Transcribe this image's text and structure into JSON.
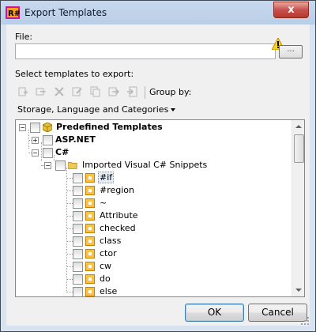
{
  "window": {
    "title": "Export Templates",
    "close_glyph": "x"
  },
  "file": {
    "label": "File:",
    "value": "",
    "placeholder": "",
    "browse_label": "...",
    "warning_icon": "warning-icon"
  },
  "templates": {
    "label": "Select templates to export:",
    "toolbar_icons": [
      "add-icon",
      "add-child-icon",
      "delete-icon",
      "edit-icon",
      "duplicate-icon",
      "move-icon",
      "export-icon"
    ],
    "group_by_label": "Group by:",
    "group_by_value": "Storage, Language and Categories"
  },
  "tree": {
    "root": "Predefined Templates",
    "asp": "ASP.NET",
    "csharp": "C#",
    "imported": "Imported Visual C# Snippets",
    "items": [
      "#if",
      "#region",
      "~",
      "Attribute",
      "checked",
      "class",
      "ctor",
      "cw",
      "do",
      "else"
    ]
  },
  "buttons": {
    "ok": "OK",
    "cancel": "Cancel"
  },
  "colors": {
    "title_bar": "#b9cde6",
    "close": "#c75050",
    "folder": "#f0c95a",
    "template_icon": "#f6c24a"
  }
}
